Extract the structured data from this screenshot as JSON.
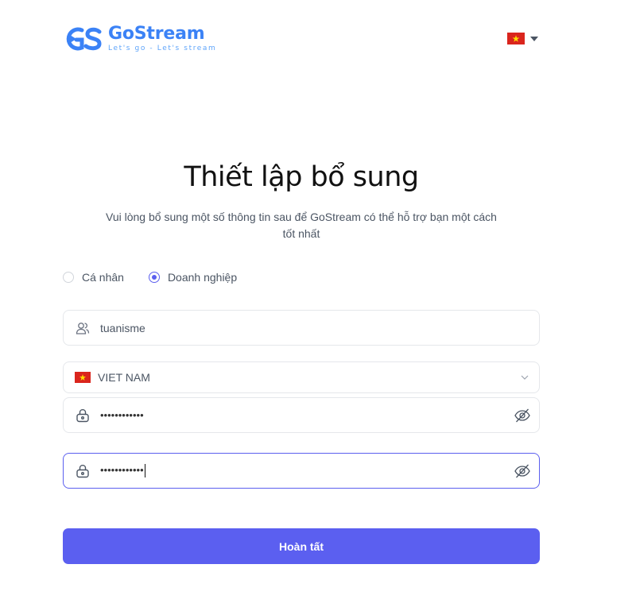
{
  "header": {
    "logo": {
      "name": "GoStream",
      "tagline": "Let's go - Let's stream",
      "mark_letters": "GS",
      "color": "#3b82f6"
    },
    "language": {
      "flag": "vietnam-flag-icon",
      "selected": "vi"
    }
  },
  "main": {
    "title": "Thiết lập bổ sung",
    "subtitle": "Vui lòng bổ sung một số thông tin sau để GoStream có thể hỗ trợ bạn một cách tốt nhất",
    "account_type": {
      "options": [
        {
          "label": "Cá nhân",
          "checked": false
        },
        {
          "label": "Doanh nghiệp",
          "checked": true
        }
      ]
    },
    "fields": {
      "username": {
        "icon": "users-icon",
        "value": "tuanisme"
      },
      "country": {
        "icon": "vietnam-flag-icon",
        "value": "VIET NAM"
      },
      "password": {
        "icon": "lock-icon",
        "value": "••••••••••••"
      },
      "confirm_password": {
        "icon": "lock-icon",
        "value": "••••••••••••"
      }
    },
    "submit_label": "Hoàn tất"
  },
  "colors": {
    "primary": "#5b5ff0",
    "logo": "#3b82f6",
    "text": "#4b5563"
  }
}
